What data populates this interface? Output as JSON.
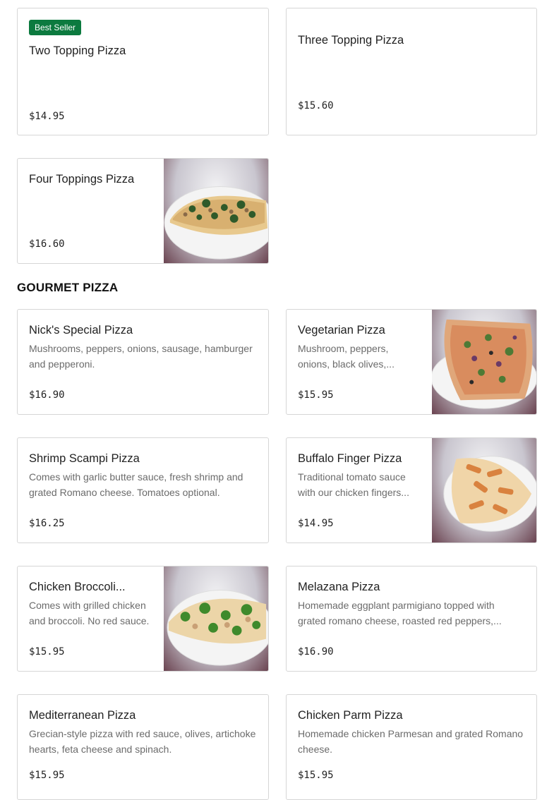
{
  "section": {
    "title": "GOURMET PIZZA"
  },
  "items": [
    {
      "name": "Two Topping Pizza",
      "badge": "Best Seller",
      "price": "$14.95",
      "desc": ""
    },
    {
      "name": "Three Topping Pizza",
      "price": "$15.60",
      "desc": ""
    },
    {
      "name": "Four Toppings Pizza",
      "price": "$16.60",
      "desc": "",
      "image": "pizza-spinach-photo"
    },
    {
      "name": "Nick's Special Pizza",
      "desc": "Mushrooms, peppers, onions, sausage, hamburger and pepperoni.",
      "price": "$16.90"
    },
    {
      "name": "Vegetarian Pizza",
      "desc": "Mushroom, peppers, onions, black olives,...",
      "price": "$15.95",
      "image": "pizza-vegetarian-photo"
    },
    {
      "name": "Shrimp Scampi Pizza",
      "desc": "Comes with garlic butter sauce, fresh shrimp and grated Romano cheese. Tomatoes optional.",
      "price": "$16.25"
    },
    {
      "name": "Buffalo Finger Pizza",
      "desc": "Traditional tomato sauce with our chicken fingers...",
      "price": "$14.95",
      "image": "pizza-buffalo-photo"
    },
    {
      "name": "Chicken Broccoli...",
      "desc": "Comes with grilled chicken and broccoli. No red sauce.",
      "price": "$15.95",
      "image": "pizza-broccoli-photo"
    },
    {
      "name": "Melazana Pizza",
      "desc": "Homemade eggplant parmigiano topped with grated romano cheese, roasted red peppers,...",
      "price": "$16.90"
    },
    {
      "name": "Mediterranean Pizza",
      "desc": "Grecian-style pizza with red sauce, olives, artichoke hearts, feta cheese and spinach.",
      "price": "$15.95"
    },
    {
      "name": "Chicken Parm Pizza",
      "desc": "Homemade chicken Parmesan and grated Romano cheese.",
      "price": "$15.95"
    }
  ],
  "colors": {
    "badge": "#0c7a3f",
    "border": "#d6d6d6",
    "muted": "#6b6b6b"
  }
}
